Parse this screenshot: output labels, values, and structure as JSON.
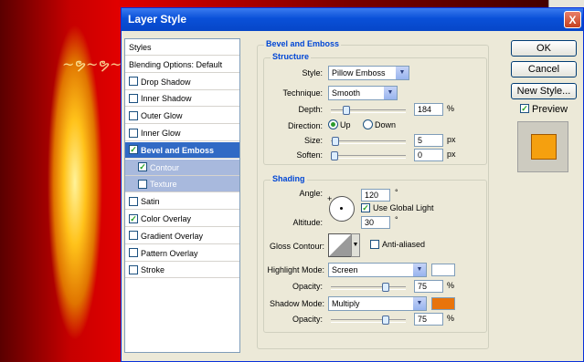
{
  "background": {
    "engraving": "~ຯ~ຯ~ຯ~ຯ~ຯ~ຯ"
  },
  "dialog": {
    "title": "Layer Style",
    "close": "X"
  },
  "left_list": [
    {
      "label": "Styles",
      "kind": "header"
    },
    {
      "label": "Blending Options: Default",
      "kind": "header"
    },
    {
      "label": "Drop Shadow",
      "checked": false
    },
    {
      "label": "Inner Shadow",
      "checked": false
    },
    {
      "label": "Outer Glow",
      "checked": false
    },
    {
      "label": "Inner Glow",
      "checked": false
    },
    {
      "label": "Bevel and Emboss",
      "checked": true,
      "selected": true
    },
    {
      "label": "Contour",
      "checked": true,
      "sub": true
    },
    {
      "label": "Texture",
      "checked": false,
      "sub": true
    },
    {
      "label": "Satin",
      "checked": false
    },
    {
      "label": "Color Overlay",
      "checked": true
    },
    {
      "label": "Gradient Overlay",
      "checked": false
    },
    {
      "label": "Pattern Overlay",
      "checked": false
    },
    {
      "label": "Stroke",
      "checked": false
    }
  ],
  "bevel": {
    "section_title": "Bevel and Emboss",
    "structure_title": "Structure",
    "style_label": "Style:",
    "style_value": "Pillow Emboss",
    "technique_label": "Technique:",
    "technique_value": "Smooth",
    "depth_label": "Depth:",
    "depth_value": "184",
    "depth_unit": "%",
    "depth_level": 0.18,
    "direction_label": "Direction:",
    "direction_up": "Up",
    "direction_down": "Down",
    "size_label": "Size:",
    "size_value": "5",
    "size_unit": "px",
    "size_level": 0.02,
    "soften_label": "Soften:",
    "soften_value": "0",
    "soften_unit": "px",
    "soften_level": 0.0
  },
  "shading": {
    "title": "Shading",
    "angle_label": "Angle:",
    "angle_value": "120",
    "angle_unit": "°",
    "global_light_label": "Use Global Light",
    "global_light": true,
    "altitude_label": "Altitude:",
    "altitude_value": "30",
    "altitude_unit": "°",
    "gloss_label": "Gloss Contour:",
    "anti_aliased_label": "Anti-aliased",
    "anti_aliased": false,
    "highlight_mode_label": "Highlight Mode:",
    "highlight_mode": "Screen",
    "highlight_color": "#ffffff",
    "hl_opacity_label": "Opacity:",
    "hl_opacity_value": "75",
    "hl_opacity_unit": "%",
    "hl_opacity_level": 0.75,
    "shadow_mode_label": "Shadow Mode:",
    "shadow_mode": "Multiply",
    "shadow_color": "#e8740c",
    "sh_opacity_label": "Opacity:",
    "sh_opacity_value": "75",
    "sh_opacity_unit": "%",
    "sh_opacity_level": 0.75
  },
  "buttons": {
    "ok": "OK",
    "cancel": "Cancel",
    "new_style": "New Style...",
    "preview": "Preview",
    "preview_checked": true
  },
  "preview_color": "#f5a00f"
}
